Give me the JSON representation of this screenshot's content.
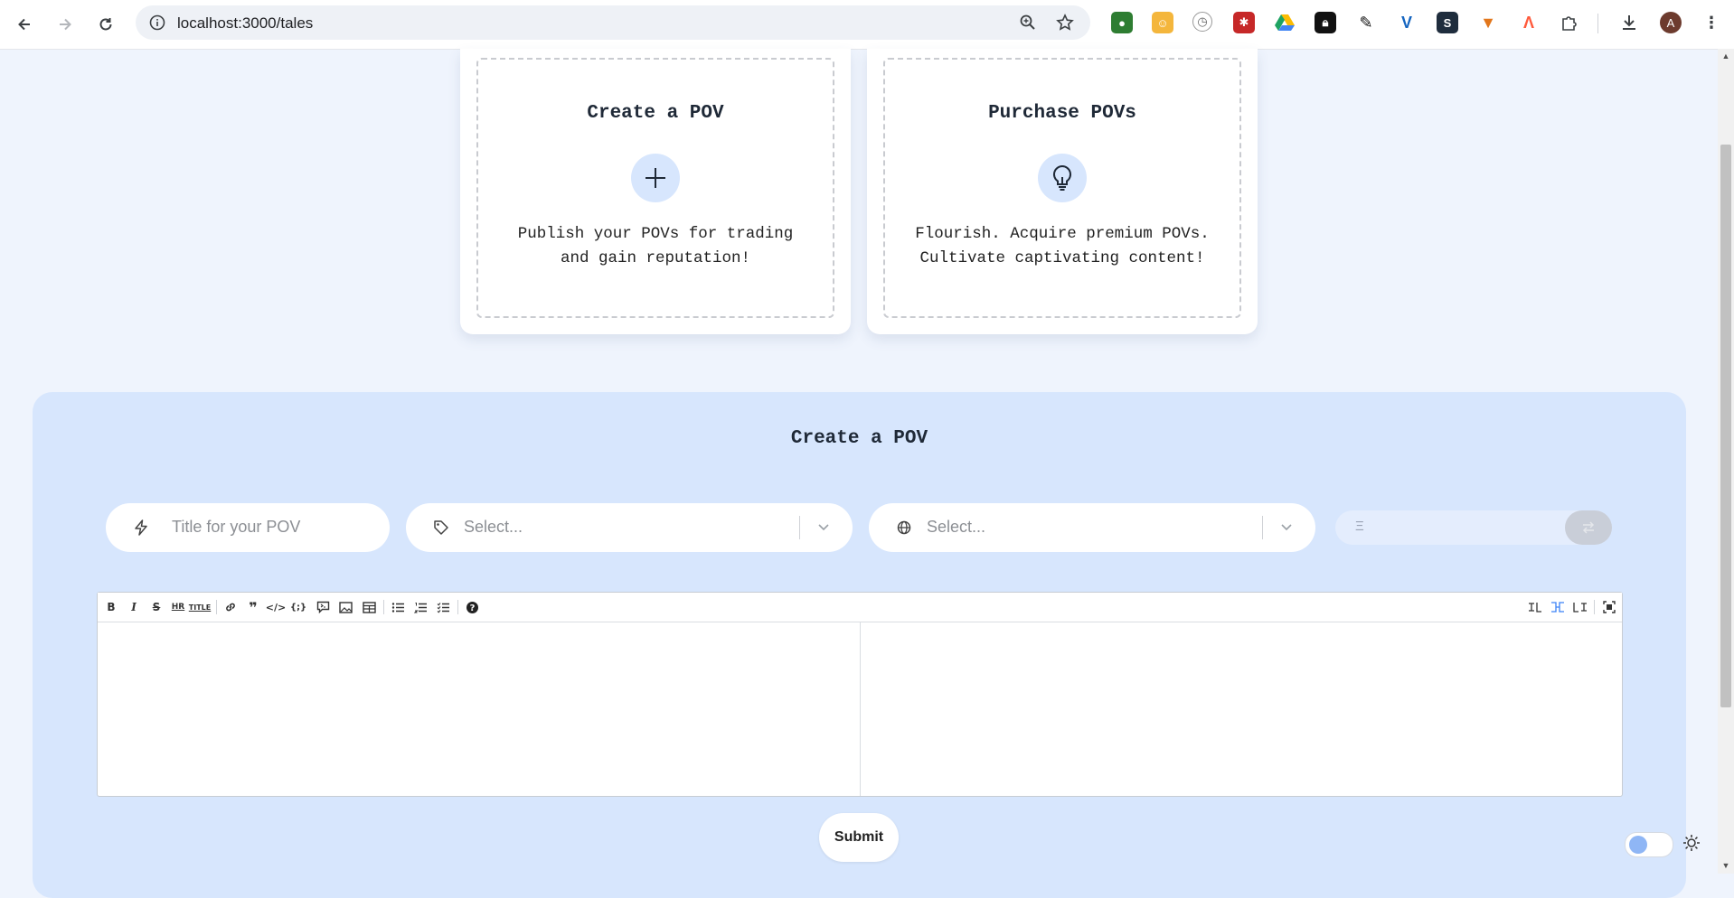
{
  "browser": {
    "url": "localhost:3000/tales",
    "profile_initial": "A"
  },
  "cards": [
    {
      "title": "Create a POV",
      "icon": "plus-icon",
      "description_line1": "Publish your POVs for trading",
      "description_line2": "and gain reputation!"
    },
    {
      "title": "Purchase POVs",
      "icon": "lightbulb-icon",
      "description_line1": "Flourish. Acquire premium POVs.",
      "description_line2": "Cultivate captivating content!"
    }
  ],
  "create_form": {
    "title": "Create a POV",
    "title_placeholder": "Title for your POV",
    "tag_select_placeholder": "Select...",
    "language_select_placeholder": "Select...",
    "price_placeholder": "Ξ",
    "submit_label": "Submit"
  },
  "colors": {
    "page_bg": "#eff4fd",
    "panel_bg": "#d7e6fd",
    "accent": "#8fb6f5"
  }
}
